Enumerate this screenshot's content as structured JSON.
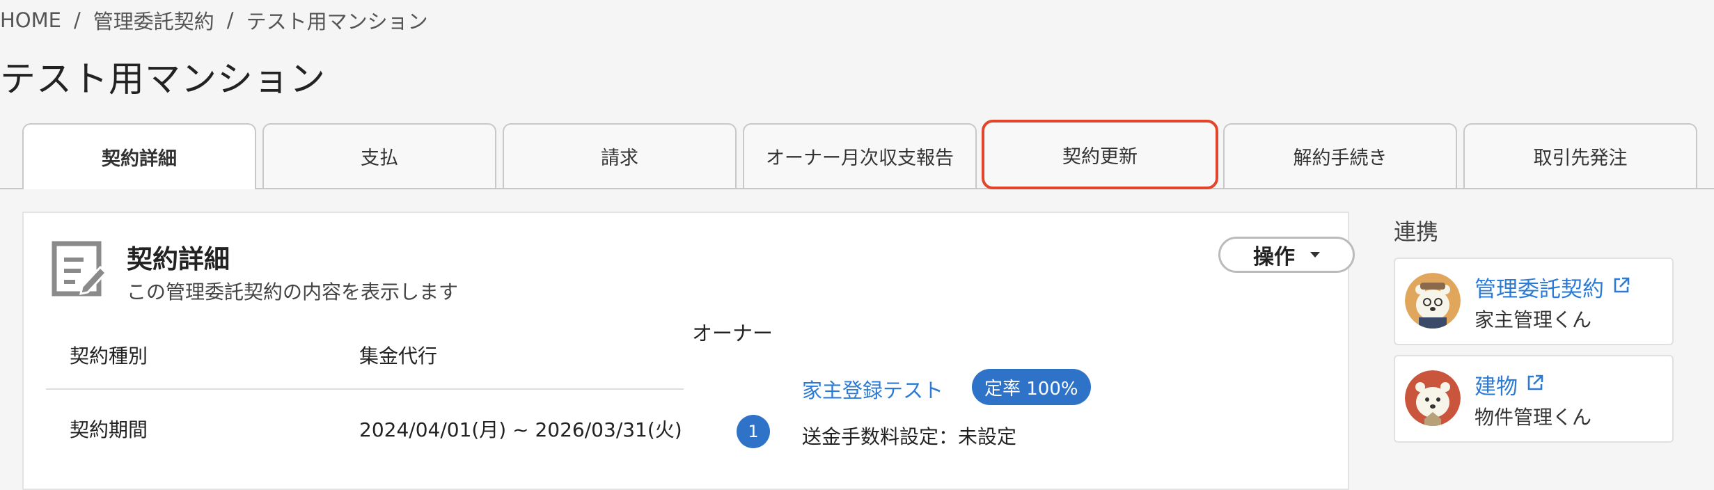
{
  "breadcrumb": {
    "items": [
      "HOME",
      "管理委託契約",
      "テスト用マンション"
    ],
    "separator": "/"
  },
  "page_title": "テスト用マンション",
  "tabs": [
    {
      "label": "契約詳細",
      "active": true
    },
    {
      "label": "支払"
    },
    {
      "label": "請求"
    },
    {
      "label": "オーナー月次収支報告"
    },
    {
      "label": "契約更新",
      "highlighted": true
    },
    {
      "label": "解約手続き"
    },
    {
      "label": "取引先発注"
    }
  ],
  "card": {
    "icon": "edit-document-icon",
    "title": "契約詳細",
    "subtitle": "この管理委託契約の内容を表示します",
    "operation_button": "操作",
    "rows": [
      {
        "label": "契約種別",
        "value": "集金代行"
      },
      {
        "label": "契約期間",
        "value": "2024/04/01(月) ~ 2026/03/31(火)"
      }
    ],
    "owner": {
      "heading": "オーナー",
      "name": "家主登録テスト",
      "badge": "定率 100%",
      "number": "1",
      "fee_setting": "送金手数料設定：未設定"
    }
  },
  "sidebar": {
    "heading": "連携",
    "links": [
      {
        "title": "管理委託契約",
        "subtitle": "家主管理くん",
        "icon": "external-link-icon"
      },
      {
        "title": "建物",
        "subtitle": "物件管理くん",
        "icon": "external-link-icon"
      }
    ]
  },
  "colors": {
    "accent_blue": "#2f73c8",
    "link_blue": "#2b7bd6",
    "highlight_red": "#e2452b"
  }
}
